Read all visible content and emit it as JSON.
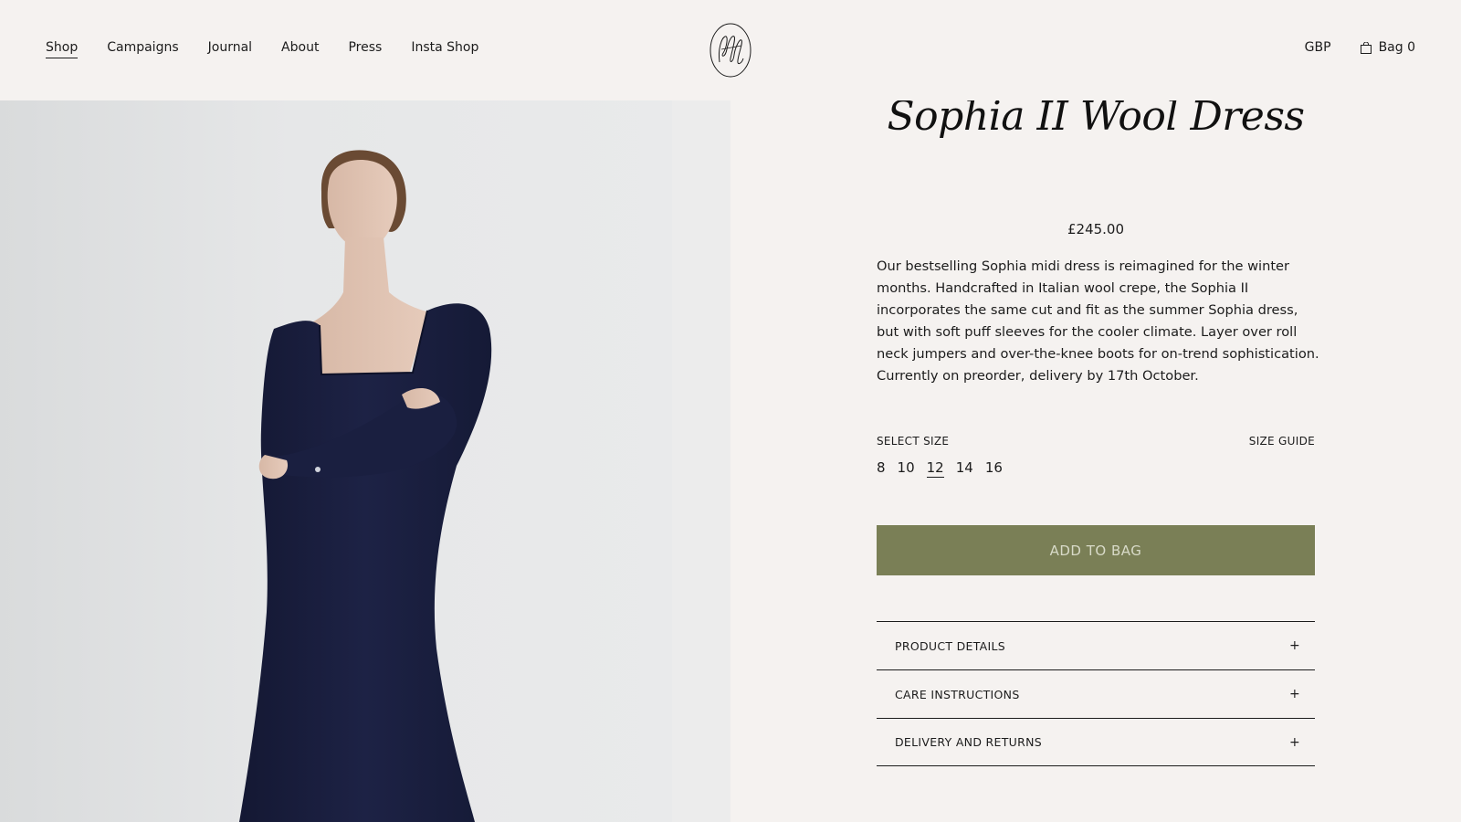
{
  "nav": {
    "items": [
      {
        "label": "Shop",
        "active": true
      },
      {
        "label": "Campaigns",
        "active": false
      },
      {
        "label": "Journal",
        "active": false
      },
      {
        "label": "About",
        "active": false
      },
      {
        "label": "Press",
        "active": false
      },
      {
        "label": "Insta Shop",
        "active": false
      }
    ]
  },
  "header": {
    "currency": "GBP",
    "bag_label": "Bag 0"
  },
  "product": {
    "title": "Sophia II Wool Dress",
    "price": "£245.00",
    "description": [
      "Our bestselling Sophia midi dress is reimagined for the winter months. Handcrafted in Italian wool crepe, the Sophia II incorporates the same cut and fit as the summer Sophia dress, but with soft puff sleeves for the cooler climate. Layer over roll neck jumpers and over-the-knee boots for on-trend sophistication.",
      "Currently on preorder, delivery by 17th October."
    ],
    "select_size_label": "SELECT SIZE",
    "size_guide_label": "SIZE GUIDE",
    "sizes": [
      "8",
      "10",
      "12",
      "14",
      "16"
    ],
    "selected_size": "12",
    "add_to_bag_label": "ADD TO BAG"
  },
  "accordion": [
    {
      "label": "PRODUCT DETAILS",
      "icon": "+"
    },
    {
      "label": "CARE INSTRUCTIONS",
      "icon": "+"
    },
    {
      "label": "DELIVERY AND RETURNS",
      "icon": "+"
    }
  ],
  "colors": {
    "background": "#f5f2f0",
    "button": "#7a7f56",
    "button_text": "#d8dac8",
    "dress": "#1b2040"
  }
}
